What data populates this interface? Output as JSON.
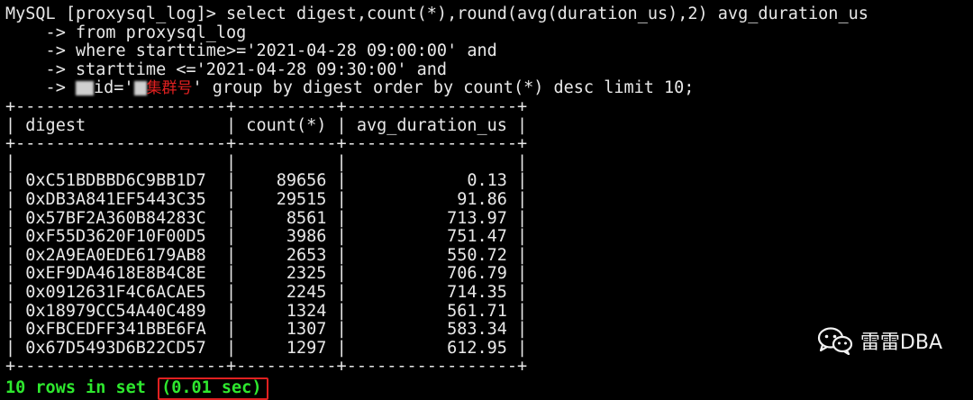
{
  "query": {
    "line1": "MySQL [proxysql_log]> select digest,count(*),round(avg(duration_us),2) avg_duration_us",
    "line2": "    -> from proxysql_log",
    "line3": "    -> where starttime>='2021-04-28 09:00:00' and",
    "line4": "    -> starttime <='2021-04-28 09:30:00' and",
    "line5_prefix": "    -> ",
    "line5_redact_label": "集群号",
    "line5_suffix": " group by digest order by count(*) desc limit 10;"
  },
  "table": {
    "border": "+---------------------+----------+-----------------+",
    "header_row": "| digest              | count(*) | avg_duration_us |",
    "blank_row": "|                     |          |                 |",
    "columns": [
      "digest",
      "count(*)",
      "avg_duration_us"
    ],
    "rows": [
      {
        "digest": "0xC51BDBBD6C9BB1D7",
        "count": "89656",
        "avg": "0.13"
      },
      {
        "digest": "0xDB3A841EF5443C35",
        "count": "29515",
        "avg": "91.86"
      },
      {
        "digest": "0x57BF2A360B84283C",
        "count": "8561",
        "avg": "713.97"
      },
      {
        "digest": "0xF55D3620F10F00D5",
        "count": "3986",
        "avg": "751.47"
      },
      {
        "digest": "0x2A9EA0EDE6179AB8",
        "count": "2653",
        "avg": "550.72"
      },
      {
        "digest": "0xEF9DA4618E8B4C8E",
        "count": "2325",
        "avg": "706.79"
      },
      {
        "digest": "0x0912631F4C6ACAE5",
        "count": "2245",
        "avg": "714.35"
      },
      {
        "digest": "0x18979CC54A40C489",
        "count": "1324",
        "avg": "561.71"
      },
      {
        "digest": "0xFBCEDFF341BBE6FA",
        "count": "1307",
        "avg": "583.34"
      },
      {
        "digest": "0x67D5493D6B22CD57",
        "count": "1297",
        "avg": "612.95"
      }
    ]
  },
  "result": {
    "rows_text": "10 rows in set ",
    "time_text": "(0.01 sec)"
  },
  "watermark": {
    "icon": "wechat-icon",
    "label": "雷雷DBA"
  },
  "colors": {
    "background": "#000000",
    "text": "#e8e8e8",
    "result_green": "#2ee82e",
    "highlight_red": "#e02020"
  }
}
